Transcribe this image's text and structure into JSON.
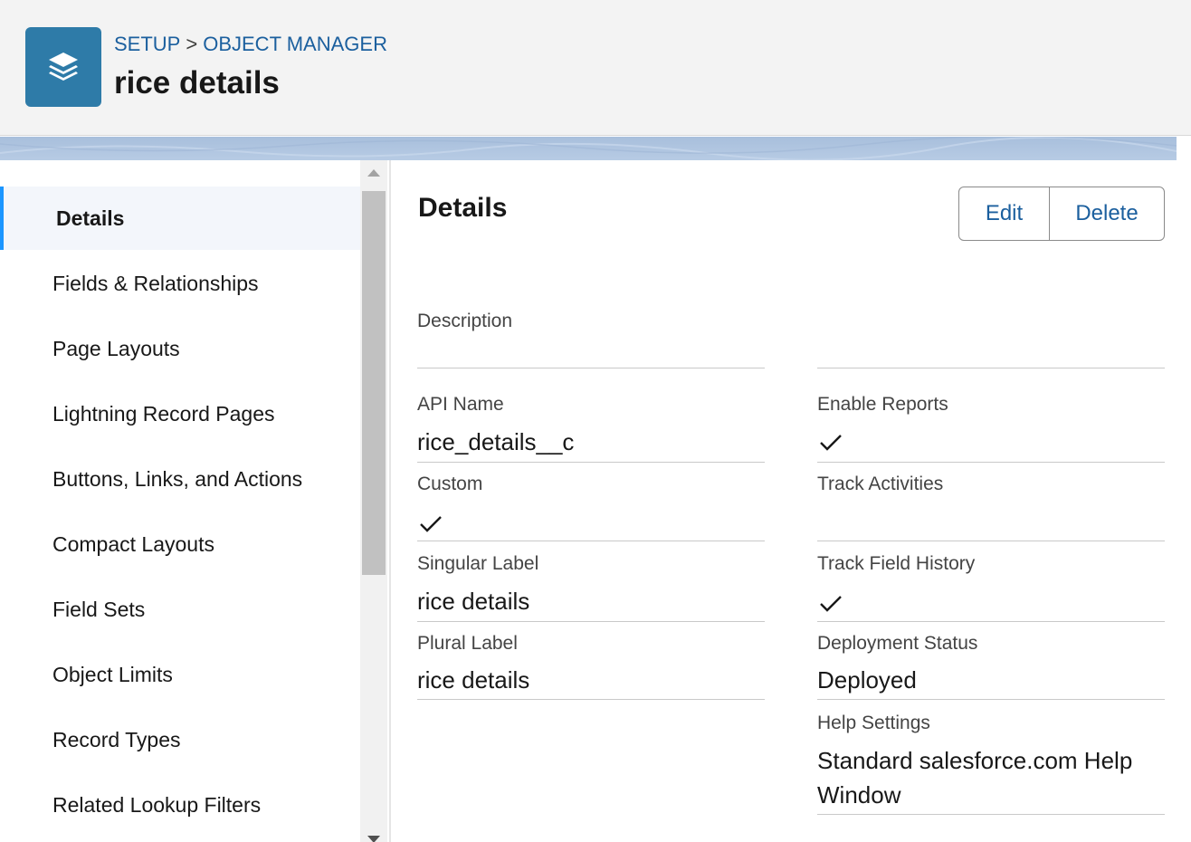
{
  "header": {
    "breadcrumb": [
      "SETUP",
      "OBJECT MANAGER"
    ],
    "breadcrumb_sep": ">",
    "title": "rice details",
    "icon": "layers-icon",
    "icon_bg": "#2e7ba8"
  },
  "sidebar": {
    "active_color": "#1b96ff",
    "items": [
      {
        "label": "Details",
        "active": true
      },
      {
        "label": "Fields & Relationships"
      },
      {
        "label": "Page Layouts"
      },
      {
        "label": "Lightning Record Pages"
      },
      {
        "label": "Buttons, Links, and Actions"
      },
      {
        "label": "Compact Layouts"
      },
      {
        "label": "Field Sets"
      },
      {
        "label": "Object Limits"
      },
      {
        "label": "Record Types"
      },
      {
        "label": "Related Lookup Filters"
      }
    ]
  },
  "main": {
    "title": "Details",
    "edit_label": "Edit",
    "delete_label": "Delete",
    "fields": {
      "description": {
        "label": "Description",
        "value": ""
      },
      "api_name": {
        "label": "API Name",
        "value": "rice_details__c"
      },
      "custom": {
        "label": "Custom",
        "checked": true
      },
      "singular_label": {
        "label": "Singular Label",
        "value": "rice details"
      },
      "plural_label": {
        "label": "Plural Label",
        "value": "rice details"
      },
      "enable_reports": {
        "label": "Enable Reports",
        "checked": true
      },
      "track_activities": {
        "label": "Track Activities",
        "checked": false
      },
      "track_field_history": {
        "label": "Track Field History",
        "checked": true
      },
      "deployment_status": {
        "label": "Deployment Status",
        "value": "Deployed"
      },
      "help_settings": {
        "label": "Help Settings",
        "value": "Standard salesforce.com Help Window"
      }
    }
  },
  "colors": {
    "link": "#1b5f9e",
    "banner": "#a8bfdc"
  }
}
